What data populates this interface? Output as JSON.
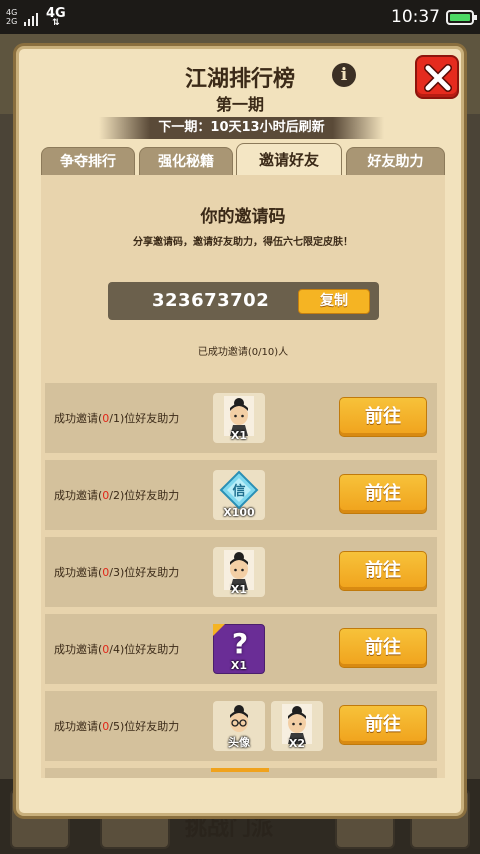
{
  "status_bar": {
    "signal_top": "4G",
    "signal_bottom": "2G",
    "network": "4G",
    "network_arrows": "⇅",
    "time": "10:37"
  },
  "background": {
    "challenge_button": "挑战门派"
  },
  "modal": {
    "title": "江湖排行榜",
    "subtitle": "第一期",
    "next_period": "下一期：10天13小时后刷新",
    "tabs": [
      {
        "label": "争夺排行",
        "active": false
      },
      {
        "label": "强化秘籍",
        "active": false
      },
      {
        "label": "邀请好友",
        "active": true
      },
      {
        "label": "好友助力",
        "active": false
      }
    ],
    "invite": {
      "heading": "你的邀请码",
      "description": "分享邀请码，邀请好友助力，得伍六七限定皮肤！",
      "code": "323673702",
      "copy_label": "复制",
      "success_count": "已成功邀请(0/10)人"
    },
    "rewards": [
      {
        "prefix": "成功邀请(",
        "progress": "0",
        "suffix": "/1)位好友助力",
        "items": [
          {
            "icon": "character-avatar-icon",
            "qty": "X1"
          }
        ],
        "button": "前往"
      },
      {
        "prefix": "成功邀请(",
        "progress": "0",
        "suffix": "/2)位好友助力",
        "items": [
          {
            "icon": "diamond-gem-icon",
            "glyph": "信",
            "qty": "X100"
          }
        ],
        "button": "前往"
      },
      {
        "prefix": "成功邀请(",
        "progress": "0",
        "suffix": "/3)位好友助力",
        "items": [
          {
            "icon": "character-avatar-icon",
            "qty": "X1"
          }
        ],
        "button": "前往"
      },
      {
        "prefix": "成功邀请(",
        "progress": "0",
        "suffix": "/4)位好友助力",
        "items": [
          {
            "icon": "mystery-box-icon",
            "glyph": "?",
            "qty": "X1"
          }
        ],
        "button": "前往"
      },
      {
        "prefix": "成功邀请(",
        "progress": "0",
        "suffix": "/5)位好友助力",
        "items": [
          {
            "icon": "avatar-frame-icon",
            "qty": "头像"
          },
          {
            "icon": "character-avatar-icon",
            "qty": "X2"
          }
        ],
        "button": "前往"
      }
    ]
  }
}
